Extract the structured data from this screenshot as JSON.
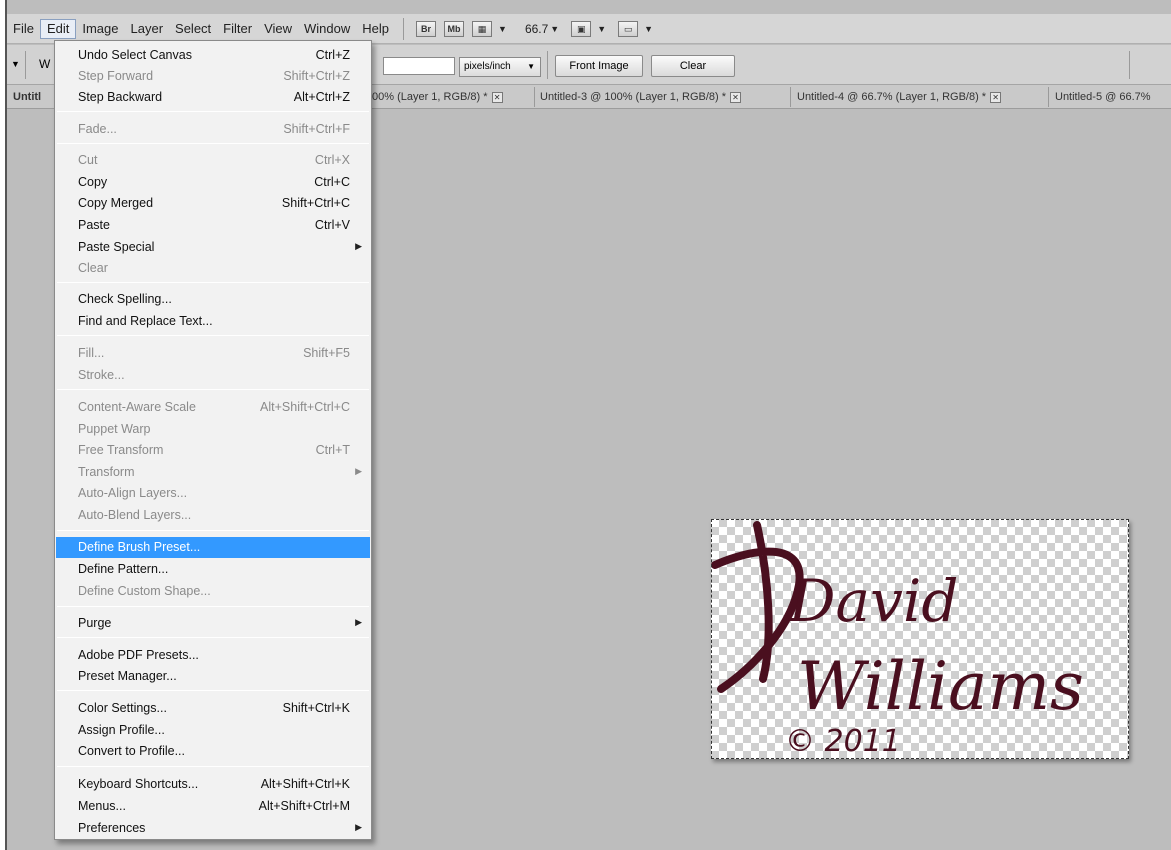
{
  "menubar": {
    "items": [
      "File",
      "Edit",
      "Image",
      "Layer",
      "Select",
      "Filter",
      "View",
      "Window",
      "Help"
    ],
    "bridge_label": "Br",
    "minibridge_label": "Mb",
    "zoom": "66.7"
  },
  "options": {
    "w_label": "W",
    "resolution_unit": "pixels/inch",
    "front_image_label": "Front Image",
    "clear_label": "Clear"
  },
  "tabs": [
    {
      "label": "Untitl"
    },
    {
      "label": "00% (Layer 1, RGB/8) *"
    },
    {
      "label": "Untitled-3 @ 100% (Layer 1, RGB/8) *"
    },
    {
      "label": "Untitled-4 @ 66.7% (Layer 1, RGB/8) *"
    },
    {
      "label": "Untitled-5 @ 66.7%"
    }
  ],
  "edit_menu": {
    "items": [
      {
        "label": "Undo Select Canvas",
        "shortcut": "Ctrl+Z"
      },
      {
        "label": "Step Forward",
        "shortcut": "Shift+Ctrl+Z"
      },
      {
        "label": "Step Backward",
        "shortcut": "Alt+Ctrl+Z"
      },
      {
        "label": "Fade...",
        "shortcut": "Shift+Ctrl+F"
      },
      {
        "label": "Cut",
        "shortcut": "Ctrl+X"
      },
      {
        "label": "Copy",
        "shortcut": "Ctrl+C"
      },
      {
        "label": "Copy Merged",
        "shortcut": "Shift+Ctrl+C"
      },
      {
        "label": "Paste",
        "shortcut": "Ctrl+V"
      },
      {
        "label": "Paste Special",
        "shortcut": ""
      },
      {
        "label": "Clear",
        "shortcut": ""
      },
      {
        "label": "Check Spelling...",
        "shortcut": ""
      },
      {
        "label": "Find and Replace Text...",
        "shortcut": ""
      },
      {
        "label": "Fill...",
        "shortcut": "Shift+F5"
      },
      {
        "label": "Stroke...",
        "shortcut": ""
      },
      {
        "label": "Content-Aware Scale",
        "shortcut": "Alt+Shift+Ctrl+C"
      },
      {
        "label": "Puppet Warp",
        "shortcut": ""
      },
      {
        "label": "Free Transform",
        "shortcut": "Ctrl+T"
      },
      {
        "label": "Transform",
        "shortcut": ""
      },
      {
        "label": "Auto-Align Layers...",
        "shortcut": ""
      },
      {
        "label": "Auto-Blend Layers...",
        "shortcut": ""
      },
      {
        "label": "Define Brush Preset...",
        "shortcut": ""
      },
      {
        "label": "Define Pattern...",
        "shortcut": ""
      },
      {
        "label": "Define Custom Shape...",
        "shortcut": ""
      },
      {
        "label": "Purge",
        "shortcut": ""
      },
      {
        "label": "Adobe PDF Presets...",
        "shortcut": ""
      },
      {
        "label": "Preset Manager...",
        "shortcut": ""
      },
      {
        "label": "Color Settings...",
        "shortcut": "Shift+Ctrl+K"
      },
      {
        "label": "Assign Profile...",
        "shortcut": ""
      },
      {
        "label": "Convert to Profile...",
        "shortcut": ""
      },
      {
        "label": "Keyboard Shortcuts...",
        "shortcut": "Alt+Shift+Ctrl+K"
      },
      {
        "label": "Menus...",
        "shortcut": "Alt+Shift+Ctrl+M"
      },
      {
        "label": "Preferences",
        "shortcut": ""
      }
    ]
  },
  "document": {
    "line1": "David",
    "line2": "Williams",
    "copyright": "© 2011",
    "ink_color": "#4a0f1f"
  }
}
